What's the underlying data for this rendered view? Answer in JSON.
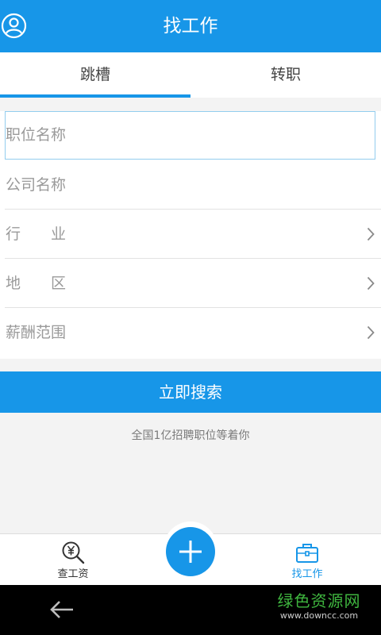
{
  "header": {
    "title": "找工作",
    "avatar_icon": "user-avatar-icon"
  },
  "tabs": [
    {
      "label": "跳槽",
      "active": true
    },
    {
      "label": "转职",
      "active": false
    }
  ],
  "form": {
    "position_placeholder": "职位名称",
    "company_placeholder": "公司名称",
    "industry_label": "行　　业",
    "region_label": "地　　区",
    "salary_label": "薪酬范围"
  },
  "search_button": "立即搜索",
  "hint": "全国1亿招聘职位等着你",
  "bottom_nav": {
    "salary": {
      "label": "查工资",
      "icon": "yen-search-icon"
    },
    "add": {
      "icon": "plus-icon"
    },
    "job": {
      "label": "找工作",
      "icon": "briefcase-icon",
      "active": true
    }
  },
  "watermark": {
    "brand": "绿色资源网",
    "url": "www.downcc.com"
  },
  "colors": {
    "primary": "#1796e8",
    "background": "#f3f3f3",
    "watermark": "#3fb63f"
  }
}
